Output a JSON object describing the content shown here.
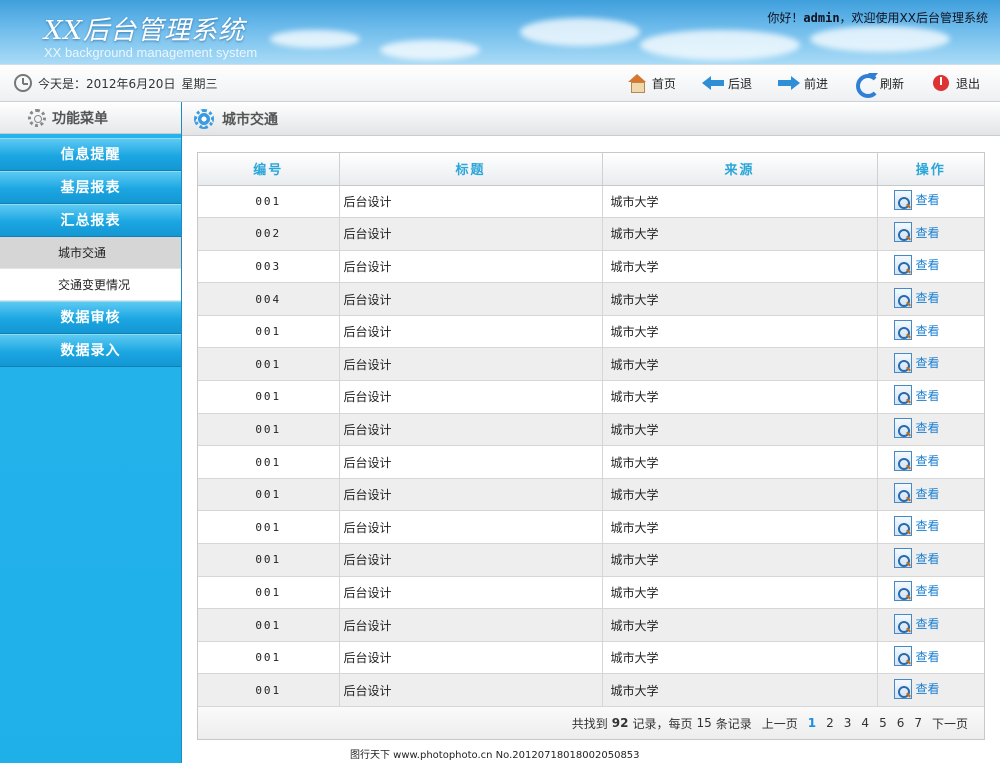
{
  "header": {
    "title": "XX后台管理系统",
    "subtitle": "XX background management system",
    "welcome_prefix": "你好！",
    "username": "admin",
    "welcome_suffix": "，欢迎使用XX后台管理系统"
  },
  "toolbar": {
    "date_text": "今天是：2012年6月20日",
    "weekday": "星期三",
    "buttons": [
      {
        "label": "首页",
        "icon": "home-icon"
      },
      {
        "label": "后退",
        "icon": "back-arrow-icon"
      },
      {
        "label": "前进",
        "icon": "forward-arrow-icon"
      },
      {
        "label": "刷新",
        "icon": "refresh-icon"
      },
      {
        "label": "退出",
        "icon": "power-icon"
      }
    ]
  },
  "sidebar": {
    "title": "功能菜单",
    "groups": [
      {
        "label": "信息提醒"
      },
      {
        "label": "基层报表"
      },
      {
        "label": "汇总报表"
      },
      {
        "label": "数据审核"
      },
      {
        "label": "数据录入"
      }
    ],
    "sub_items": [
      {
        "label": "城市交通"
      },
      {
        "label": "交通变更情况"
      }
    ]
  },
  "content": {
    "title": "城市交通",
    "columns": [
      "编号",
      "标题",
      "来源",
      "操作"
    ],
    "view_label": "查看",
    "rows": [
      {
        "id": "001",
        "title": "后台设计",
        "source": "城市大学"
      },
      {
        "id": "002",
        "title": "后台设计",
        "source": "城市大学"
      },
      {
        "id": "003",
        "title": "后台设计",
        "source": "城市大学"
      },
      {
        "id": "004",
        "title": "后台设计",
        "source": "城市大学"
      },
      {
        "id": "001",
        "title": "后台设计",
        "source": "城市大学"
      },
      {
        "id": "001",
        "title": "后台设计",
        "source": "城市大学"
      },
      {
        "id": "001",
        "title": "后台设计",
        "source": "城市大学"
      },
      {
        "id": "001",
        "title": "后台设计",
        "source": "城市大学"
      },
      {
        "id": "001",
        "title": "后台设计",
        "source": "城市大学"
      },
      {
        "id": "001",
        "title": "后台设计",
        "source": "城市大学"
      },
      {
        "id": "001",
        "title": "后台设计",
        "source": "城市大学"
      },
      {
        "id": "001",
        "title": "后台设计",
        "source": "城市大学"
      },
      {
        "id": "001",
        "title": "后台设计",
        "source": "城市大学"
      },
      {
        "id": "001",
        "title": "后台设计",
        "source": "城市大学"
      },
      {
        "id": "001",
        "title": "后台设计",
        "source": "城市大学"
      },
      {
        "id": "001",
        "title": "后台设计",
        "source": "城市大学"
      }
    ]
  },
  "pager": {
    "found_prefix": "共找到",
    "total": "92",
    "found_mid": "记录，每页",
    "per_page": "15",
    "found_suffix": "条记录",
    "prev": "上一页",
    "pages": [
      "1",
      "2",
      "3",
      "4",
      "5",
      "6",
      "7"
    ],
    "current": "1",
    "next": "下一页"
  },
  "watermark": "图行天下 www.photophoto.cn No.20120718018002050853",
  "colors": {
    "accent": "#2ca6d8",
    "sidebar": "#1fb0ea",
    "link": "#1b7fd0"
  }
}
